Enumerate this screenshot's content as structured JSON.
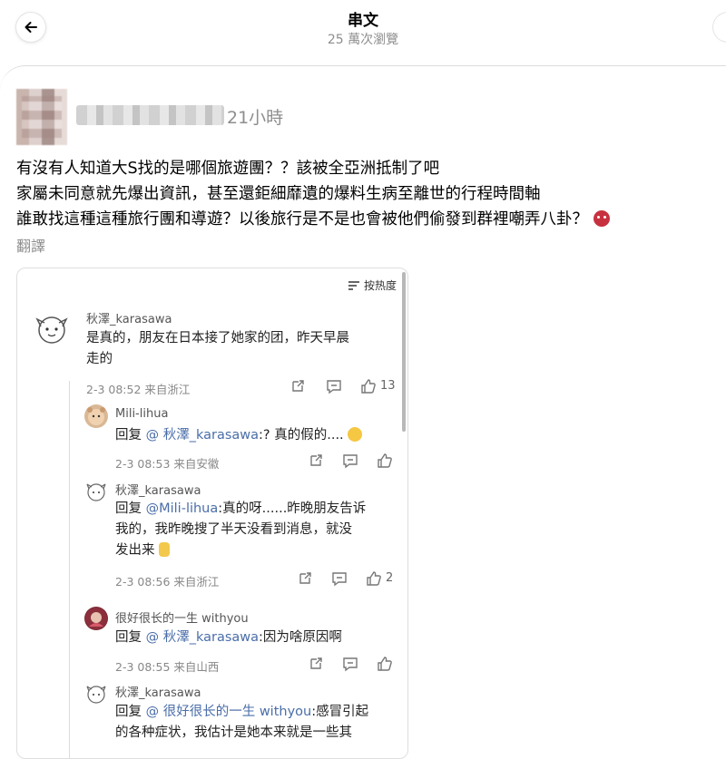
{
  "header": {
    "title": "串文",
    "views": "25 萬次瀏覽",
    "back_icon": "arrow-left-icon"
  },
  "post": {
    "time": "21小時",
    "lines": [
      "有沒有人知道大S找的是哪個旅遊團？？該被全亞洲抵制了吧",
      "家屬未同意就先爆出資訊，甚至還鉅細靡遺的爆料生病至離世的行程時間軸",
      "誰敢找這種這種旅行團和導遊？以後旅行是不是也會被他們偷發到群裡嘲弄八卦？"
    ],
    "emoji": "angry-face-emoji",
    "translate": "翻譯"
  },
  "embed": {
    "sort_label": "按热度",
    "comments": [
      {
        "name": "秋澤_karasawa",
        "text_lines": [
          "是真的，朋友在日本接了她家的团，昨天早晨",
          "走的"
        ],
        "meta": "2-3 08:52 来自浙江",
        "likes": "13"
      },
      {
        "name": "Mili-lihua",
        "reply": "回复",
        "mention": "@ 秋澤_karasawa",
        "text": ":? 真的假的....",
        "meta": "2-3 08:53 来自安徽"
      },
      {
        "name": "秋澤_karasawa",
        "reply": "回复",
        "mention": "@Mili-lihua",
        "text_first": ":真的呀......昨晚朋友告诉",
        "text_lines": [
          "我的，我昨晚搜了半天没看到消息，就没",
          "发出来"
        ],
        "meta": "2-3 08:56 来自浙江",
        "likes": "2"
      },
      {
        "name": "很好很长的一生 withyou",
        "reply": "回复",
        "mention": "@ 秋澤_karasawa",
        "text": ":因为啥原因啊",
        "meta": "2-3 08:55 来自山西"
      },
      {
        "name": "秋澤_karasawa",
        "reply": "回复",
        "mention": "@ 很好很长的一生 withyou",
        "text": ":感冒引起",
        "text_cut": "的各种症状，我估计是她本来就是一些其"
      }
    ]
  },
  "colors": {
    "mention": "#4a6ea9",
    "secondary_text": "#8e8e8e",
    "emoji_red": "#c7313f"
  }
}
